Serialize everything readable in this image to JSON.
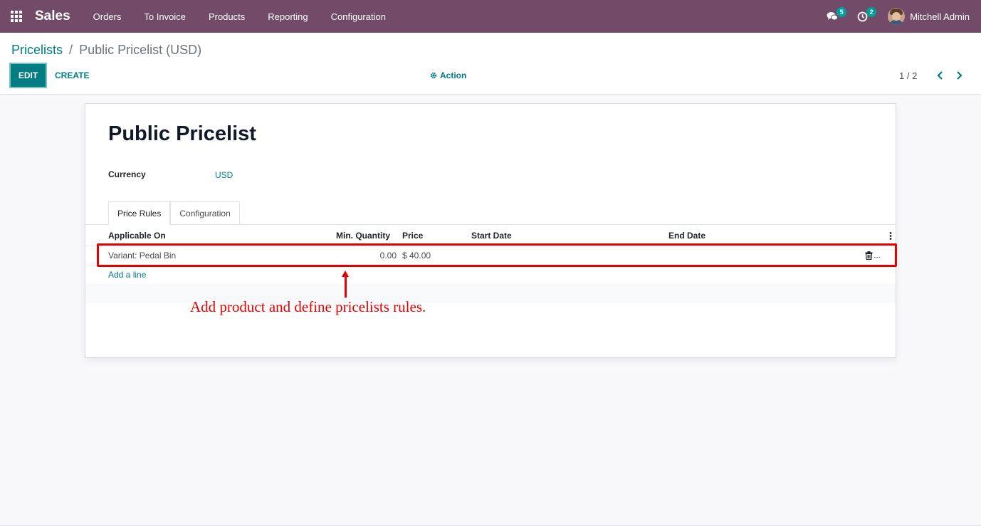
{
  "navbar": {
    "app_name": "Sales",
    "menu": [
      "Orders",
      "To Invoice",
      "Products",
      "Reporting",
      "Configuration"
    ],
    "messages_count": "5",
    "activities_count": "2",
    "user_name": "Mitchell Admin",
    "color": "#714b67"
  },
  "breadcrumb": {
    "parent": "Pricelists",
    "separator": "/",
    "current": "Public Pricelist (USD)"
  },
  "toolbar": {
    "edit_label": "EDIT",
    "create_label": "CREATE",
    "action_label": "Action",
    "pager": "1 / 2"
  },
  "record": {
    "title": "Public Pricelist",
    "currency_label": "Currency",
    "currency_value": "USD"
  },
  "tabs": [
    {
      "label": "Price Rules",
      "active": true
    },
    {
      "label": "Configuration",
      "active": false
    }
  ],
  "table": {
    "columns": [
      "Applicable On",
      "Min. Quantity",
      "Price",
      "Start Date",
      "End Date"
    ],
    "rows": [
      {
        "applicable_on": "Variant: Pedal Bin",
        "min_quantity": "0.00",
        "price": "$ 40.00",
        "start_date": "",
        "end_date": ""
      }
    ],
    "add_line_label": "Add a line"
  },
  "annotation": {
    "text": "Add product and define pricelists rules.",
    "color": "#e60000"
  },
  "colors": {
    "accent": "#017e84"
  }
}
